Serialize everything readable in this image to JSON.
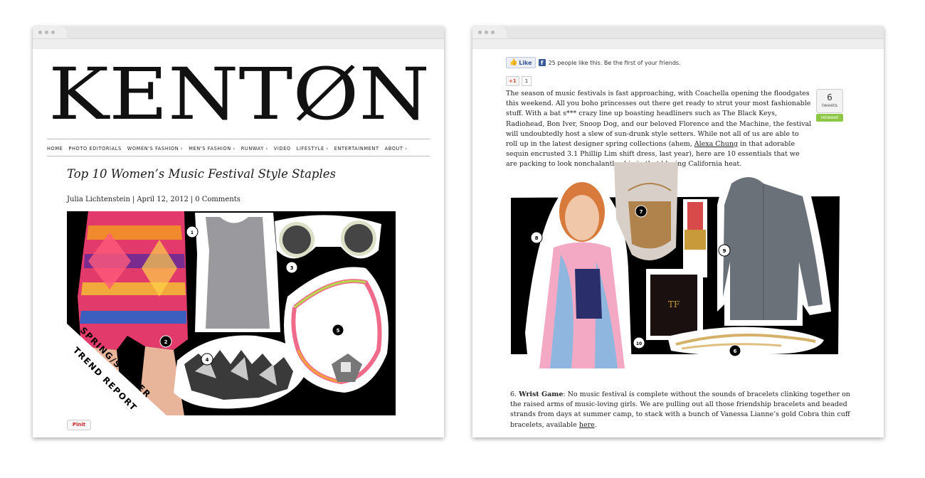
{
  "left_window": {
    "logo_text": "KENTØN",
    "nav": [
      "HOME",
      "PHOTO EDITORIALS",
      "WOMEN'S FASHION ›",
      "MEN'S FASHION ›",
      "RUNWAY ›",
      "VIDEO",
      "LIFESTYLE ›",
      "ENTERTAINMENT",
      "ABOUT ›"
    ],
    "post_title": "Top 10 Women’s Music Festival Style Staples",
    "byline": {
      "author": "Julia Lichtenstein",
      "date": "April 12, 2012",
      "comments": "0 Comments",
      "separator": "|"
    },
    "collage": {
      "banner_line1": "SPRING/SUMMER",
      "banner_line2": "TREND REPORT",
      "numbers": [
        "1",
        "2",
        "3",
        "4",
        "5"
      ]
    },
    "pinit_label": "Pinit"
  },
  "right_window": {
    "fb_like_label": "Like",
    "fb_text": "25 people like this. Be the first of your friends.",
    "gplus_label": "+1",
    "gplus_count": "1",
    "tweet_count": "6",
    "tweet_label": "tweets",
    "retweet_label": "retweet",
    "intro": {
      "part1": "The season of music festivals is fast approaching, with Coachella opening the floodgates this weekend. All you boho princesses out there get ready to strut your most fashionable stuff. With a bat s*** crazy line up boasting headliners such as The Black Keys, Radiohead, Bon Iver, Snoop Dog, and our beloved Florence and the Machine, the festival will undoubtedly host a slew of sun-drunk style setters. While not all of us are able to roll up in the latest designer spring collections (ahem, ",
      "link": "Alexa Chung",
      "part2": " in that adorable sequin encrusted 3.1 Phillip Lim shift dress, last year), here are 10 essentials that we are packing to look nonchalantly chic in that blazing California heat."
    },
    "collage": {
      "numbers": [
        "7",
        "8",
        "9",
        "10",
        "6"
      ],
      "lipstick_brand": "TF"
    },
    "bottom": {
      "number": "6. ",
      "heading": "Wrist Game",
      "body": ": No music festival is complete without the sounds of bracelets clinking together on the raised arms of music-loving girls. We are pulling out all those friendship bracelets and beaded strands from days at summer camp, to stack with a bunch of Vanessa Lianne’s gold Cobra thin cuff bracelets, available ",
      "link": "here",
      "end": "."
    }
  },
  "colors": {
    "fb_blue": "#3b5998",
    "retweet_green": "#8ec745",
    "pinit_red": "#c8232c",
    "gplus_red": "#d14836"
  }
}
